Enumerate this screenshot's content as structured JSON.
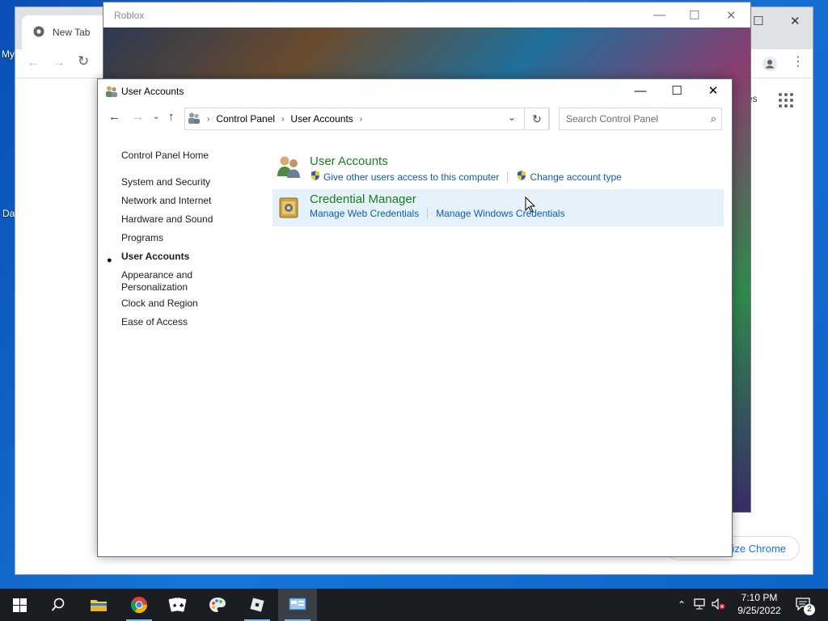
{
  "desktop": {
    "labels": [
      "My",
      "Da"
    ]
  },
  "chrome": {
    "tab_title": "New Tab",
    "customize_label": "mize Chrome",
    "partial_link": "es"
  },
  "roblox": {
    "title": "Roblox"
  },
  "control_panel": {
    "window_title": "User Accounts",
    "address": {
      "crumbs": [
        "Control Panel",
        "User Accounts"
      ]
    },
    "search": {
      "placeholder": "Search Control Panel"
    },
    "left_nav": {
      "home": "Control Panel Home",
      "items": [
        "System and Security",
        "Network and Internet",
        "Hardware and Sound",
        "Programs",
        "User Accounts",
        "Appearance and Personalization",
        "Clock and Region",
        "Ease of Access"
      ],
      "active_index": 4
    },
    "categories": [
      {
        "title": "User Accounts",
        "links": [
          "Give other users access to this computer",
          "Change account type"
        ]
      },
      {
        "title": "Credential Manager",
        "links": [
          "Manage Web Credentials",
          "Manage Windows Credentials"
        ]
      }
    ]
  },
  "taskbar": {
    "apps": [
      "start-button",
      "search",
      "file-explorer",
      "chrome",
      "solitaire",
      "paint",
      "roblox",
      "control-panel"
    ],
    "time": "7:10 PM",
    "date": "9/25/2022",
    "notification_count": "2"
  },
  "colors": {
    "accent_link": "#0b5faf",
    "category_title": "#1e7b1e",
    "hover_bg": "#e5f1fb"
  }
}
